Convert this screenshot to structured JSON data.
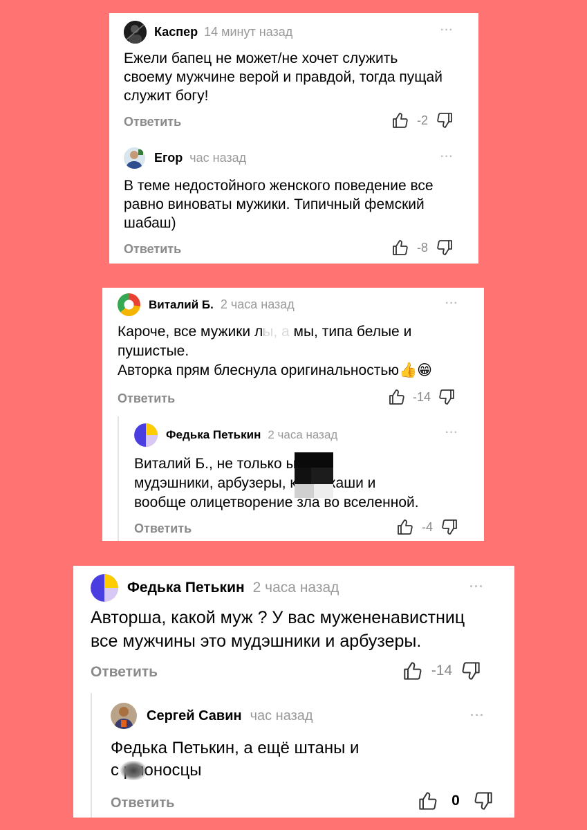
{
  "reply_label": "Ответить",
  "more_label": "···",
  "colors": {
    "background": "#ff7472",
    "name": "#000000",
    "time": "#999999",
    "reply": "#8a8a8a"
  },
  "cards": [
    {
      "comments": [
        {
          "author": "Каспер",
          "time": "14 минут назад",
          "avatar": "dark-photo-avatar",
          "text": "Ежели бапец не может/не хочет служить\nсвоему мужчине верой и правдой, тогда пущай\nслужит богу!",
          "votes": "-2"
        },
        {
          "author": "Егор",
          "time": "час назад",
          "avatar": "photo-avatar",
          "text": "В теме недостойного женского поведение все\nравно виноваты мужики. Типичный фемский\nшабаш)",
          "votes": "-8"
        }
      ]
    },
    {
      "comments": [
        {
          "author": "Виталий Б.",
          "time": "2 часа назад",
          "avatar": "pie-avatar",
          "text": "Кароче, все мужики       лы, а мы, типа белые и\nпушистые.\nАвторка прям блеснула оригинальностью👍😁",
          "votes": "-14"
        },
        {
          "author": "Федька Петькин",
          "time": "2 часа назад",
          "avatar": "yellow-violet-avatar",
          "text": "Виталий Б., не только         ы, ещё\nмудэшники, арбузеры,          ки, алкаши и\nвообще олицетворение зла во вселенной.",
          "votes": "-4"
        }
      ]
    },
    {
      "comments": [
        {
          "author": "Федька Петькин",
          "time": "2 часа назад",
          "avatar": "yellow-violet-avatar",
          "text": "Авторша, какой муж ? У вас мужененавистниц\nвсе мужчины это мудэшники и арбузеры.",
          "votes": "-14"
        },
        {
          "author": "Сергей Савин",
          "time": "час назад",
          "avatar": "photo-avatar",
          "text": "Федька Петькин, а ещё штаны и\nс     рмоносцы",
          "votes": "0"
        }
      ]
    }
  ]
}
